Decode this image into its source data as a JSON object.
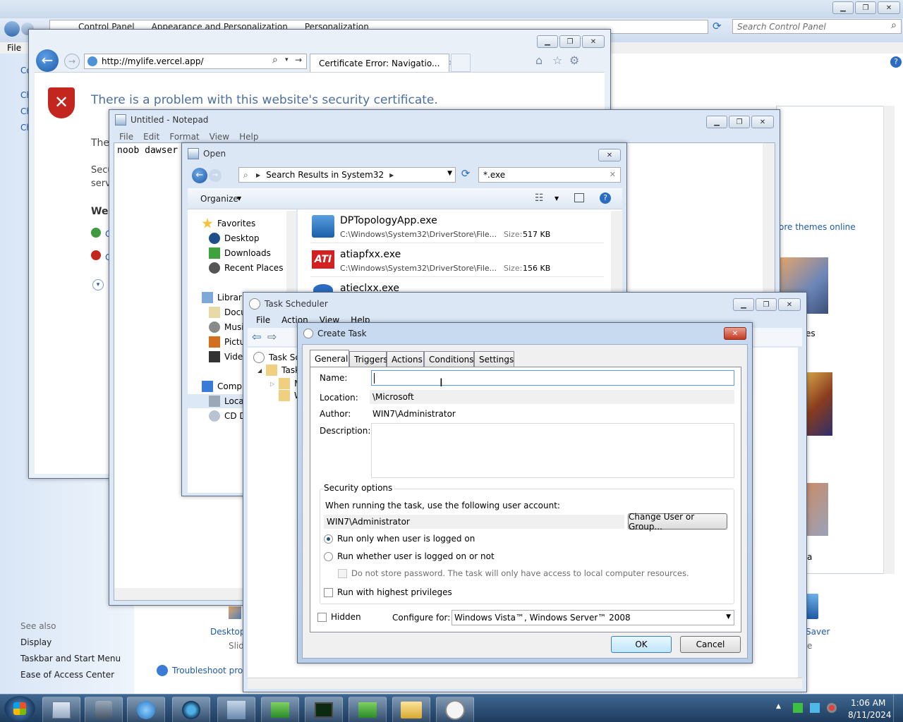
{
  "control_panel": {
    "breadcrumb": [
      "Control Panel",
      "Appearance and Personalization",
      "Personalization"
    ],
    "search_placeholder": "Search Control Panel",
    "menu_file": "File",
    "left_fragments": [
      "Co",
      "Ch",
      "Ch",
      "Ch"
    ],
    "see_also_title": "See also",
    "see_also_links": [
      "Display",
      "Taskbar and Start Menu",
      "Ease of Access Center"
    ],
    "desktop_label": "Desktop",
    "desktop_sub": "Slid",
    "troubleshoot": "Troubleshoot prob",
    "themes_online": "ore themes online",
    "frag_es": "es",
    "frag_a": "a",
    "saver": "Saver",
    "saver_sub": "e"
  },
  "browser": {
    "url": "http://mylife.vercel.app/",
    "tab_title": "Certificate Error: Navigatio...",
    "heading": "There is a problem with this website's security certificate.",
    "frag_the": "The",
    "frag_secu": "Secu",
    "frag_serv": "serv",
    "frag_we": "We",
    "frag_c1": "C",
    "frag_c2": "C"
  },
  "notepad": {
    "title": "Untitled - Notepad",
    "menu": [
      "File",
      "Edit",
      "Format",
      "View",
      "Help"
    ],
    "content": "noob dawser"
  },
  "open_dialog": {
    "title": "Open",
    "path": "Search Results in System32",
    "search_value": "*.exe",
    "organize": "Organize",
    "nav": {
      "favorites": "Favorites",
      "desktop": "Desktop",
      "downloads": "Downloads",
      "recent": "Recent Places",
      "libraries": "Librarie",
      "documents": "Docu",
      "music": "Musi",
      "pictures": "Pictu",
      "videos": "Vide",
      "computer": "Compu",
      "local": "Local",
      "cd": "CD D"
    },
    "files": [
      {
        "name": "DPTopologyApp.exe",
        "path": "C:\\Windows\\System32\\DriverStore\\File...",
        "size_label": "Size:",
        "size": "517 KB"
      },
      {
        "name": "atiapfxx.exe",
        "path": "C:\\Windows\\System32\\DriverStore\\File...",
        "size_label": "Size:",
        "size": "156 KB"
      },
      {
        "name": "atieclxx.exe"
      }
    ]
  },
  "task_scheduler": {
    "title": "Task Scheduler",
    "menu": [
      "File",
      "Action",
      "View",
      "Help"
    ],
    "tree_root": "Task Sch",
    "tree_child": "Task",
    "tree_m": "M",
    "tree_w": "W"
  },
  "create_task": {
    "title": "Create Task",
    "tabs": [
      "General",
      "Triggers",
      "Actions",
      "Conditions",
      "Settings"
    ],
    "name_label": "Name:",
    "name_value": "",
    "location_label": "Location:",
    "location_value": "\\Microsoft",
    "author_label": "Author:",
    "author_value": "WIN7\\Administrator",
    "description_label": "Description:",
    "security_title": "Security options",
    "account_prompt": "When running the task, use the following user account:",
    "account_value": "WIN7\\Administrator",
    "change_user_button": "Change User or Group...",
    "radio_logged_on": "Run only when user is logged on",
    "radio_whether": "Run whether user is logged on or not",
    "no_store_password": "Do not store password.  The task will only have access to local computer resources.",
    "highest_privileges": "Run with highest privileges",
    "hidden_label": "Hidden",
    "configure_label": "Configure for:",
    "configure_value": "Windows Vista™, Windows Server™ 2008",
    "ok_button": "OK",
    "cancel_button": "Cancel"
  },
  "taskbar": {
    "time": "1:06 AM",
    "date": "8/11/2024"
  },
  "colors": {
    "taskbar": "#2b4c73",
    "link": "#1e5aa8",
    "ie_heading": "#4a6fa0",
    "error_red": "#c2261f"
  }
}
